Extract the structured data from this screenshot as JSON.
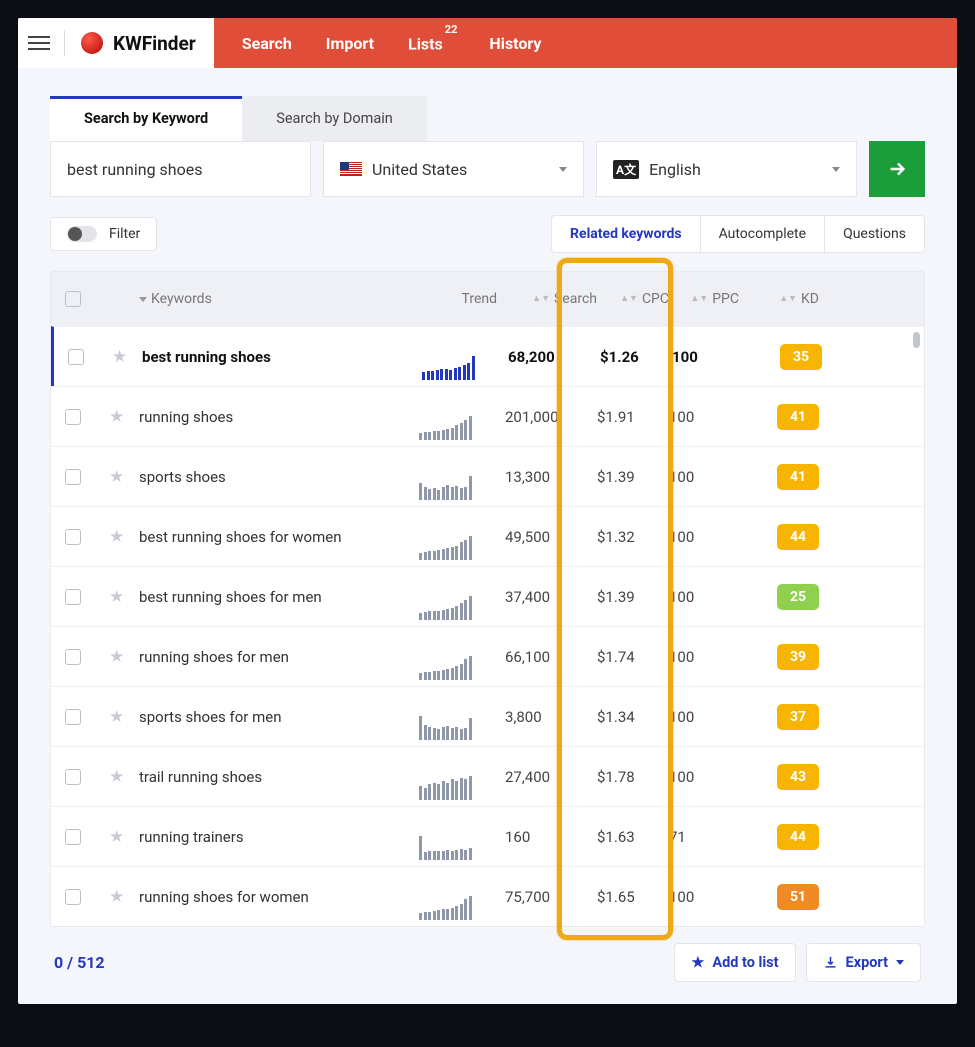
{
  "brand": {
    "name": "KWFinder"
  },
  "nav": {
    "search": "Search",
    "import": "Import",
    "lists": "Lists",
    "lists_count": "22",
    "history": "History"
  },
  "tabs": {
    "keyword": "Search by Keyword",
    "domain": "Search by Domain"
  },
  "search": {
    "query": "best running shoes",
    "country": "United States",
    "language": "English"
  },
  "filter_label": "Filter",
  "seg": {
    "related": "Related keywords",
    "autocomplete": "Autocomplete",
    "questions": "Questions"
  },
  "columns": {
    "keywords": "Keywords",
    "trend": "Trend",
    "search": "Search",
    "cpc": "CPC",
    "ppc": "PPC",
    "kd": "KD"
  },
  "rows": [
    {
      "keyword": "best running shoes",
      "search": "68,200",
      "cpc": "$1.26",
      "ppc": "100",
      "kd": "35",
      "kd_color": "#f7b500",
      "active": true,
      "trend": [
        4,
        5,
        6,
        7,
        8,
        8,
        7,
        9,
        10,
        12,
        14,
        22
      ]
    },
    {
      "keyword": "running shoes",
      "search": "201,000",
      "cpc": "$1.91",
      "ppc": "100",
      "kd": "41",
      "kd_color": "#f7b500",
      "active": false,
      "trend": [
        3,
        4,
        4,
        5,
        6,
        7,
        8,
        9,
        12,
        14,
        18,
        22
      ]
    },
    {
      "keyword": "sports shoes",
      "search": "13,300",
      "cpc": "$1.39",
      "ppc": "100",
      "kd": "41",
      "kd_color": "#f7b500",
      "active": false,
      "trend": [
        14,
        10,
        8,
        9,
        7,
        10,
        12,
        10,
        11,
        9,
        10,
        22
      ]
    },
    {
      "keyword": "best running shoes for women",
      "search": "49,500",
      "cpc": "$1.32",
      "ppc": "100",
      "kd": "44",
      "kd_color": "#f7b500",
      "active": false,
      "trend": [
        3,
        4,
        5,
        5,
        6,
        7,
        8,
        9,
        10,
        14,
        16,
        20
      ]
    },
    {
      "keyword": "best running shoes for men",
      "search": "37,400",
      "cpc": "$1.39",
      "ppc": "100",
      "kd": "25",
      "kd_color": "#8fd14f",
      "active": false,
      "trend": [
        3,
        4,
        5,
        6,
        6,
        7,
        8,
        9,
        11,
        14,
        18,
        22
      ]
    },
    {
      "keyword": "running shoes for men",
      "search": "66,100",
      "cpc": "$1.74",
      "ppc": "100",
      "kd": "39",
      "kd_color": "#f7b500",
      "active": false,
      "trend": [
        4,
        5,
        5,
        6,
        6,
        7,
        8,
        10,
        12,
        15,
        20,
        24
      ]
    },
    {
      "keyword": "sports shoes for men",
      "search": "3,800",
      "cpc": "$1.34",
      "ppc": "100",
      "kd": "37",
      "kd_color": "#f7b500",
      "active": false,
      "trend": [
        22,
        12,
        10,
        9,
        8,
        10,
        11,
        9,
        10,
        8,
        9,
        20
      ]
    },
    {
      "keyword": "trail running shoes",
      "search": "27,400",
      "cpc": "$1.78",
      "ppc": "100",
      "kd": "43",
      "kd_color": "#f7b500",
      "active": false,
      "trend": [
        6,
        5,
        7,
        8,
        7,
        9,
        8,
        10,
        9,
        11,
        10,
        12
      ]
    },
    {
      "keyword": "running trainers",
      "search": "160",
      "cpc": "$1.63",
      "ppc": "71",
      "kd": "44",
      "kd_color": "#f7b500",
      "active": false,
      "trend": [
        22,
        4,
        5,
        6,
        5,
        6,
        7,
        6,
        7,
        8,
        7,
        9
      ]
    },
    {
      "keyword": "running shoes for women",
      "search": "75,700",
      "cpc": "$1.65",
      "ppc": "100",
      "kd": "51",
      "kd_color": "#f08a24",
      "active": false,
      "trend": [
        4,
        5,
        5,
        6,
        7,
        8,
        9,
        10,
        12,
        15,
        20,
        24
      ]
    }
  ],
  "pager": "0 / 512",
  "footer": {
    "add": "Add to list",
    "export": "Export"
  }
}
